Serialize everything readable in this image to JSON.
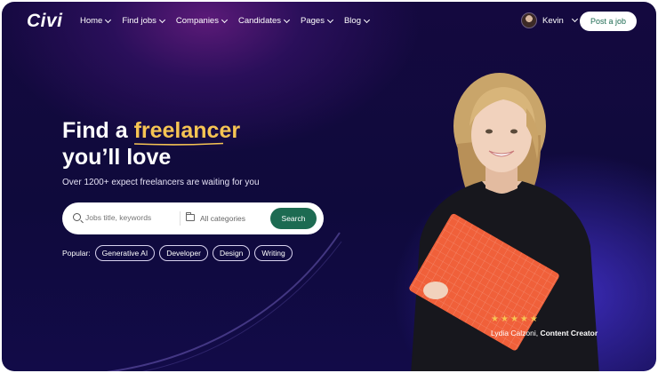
{
  "brand": {
    "logo": "Civi"
  },
  "nav": {
    "items": [
      {
        "label": "Home"
      },
      {
        "label": "Find jobs"
      },
      {
        "label": "Companies"
      },
      {
        "label": "Candidates"
      },
      {
        "label": "Pages"
      },
      {
        "label": "Blog"
      }
    ],
    "user_name": "Kevin",
    "post_job": "Post a job"
  },
  "hero": {
    "headline_pre": "Find a ",
    "headline_highlight": "freelancer",
    "headline_line2": "you’ll  love",
    "subline": "Over 1200+ expect freelancers are waiting for you"
  },
  "search": {
    "keyword_placeholder": "Jobs title, keywords",
    "category": "All categories",
    "button": "Search"
  },
  "popular": {
    "label": "Popular:",
    "tags": [
      "Generative AI",
      "Developer",
      "Design",
      "Writing"
    ]
  },
  "testimonial": {
    "stars": 5,
    "name": "Lydia Calzoni",
    "role": "Content Creator"
  },
  "colors": {
    "accent_green": "#1d6b52",
    "highlight_yellow": "#f6c453",
    "background": "#14093f"
  },
  "icons": [
    "search-icon",
    "folder-icon",
    "chevron-down-icon",
    "star-icon"
  ]
}
